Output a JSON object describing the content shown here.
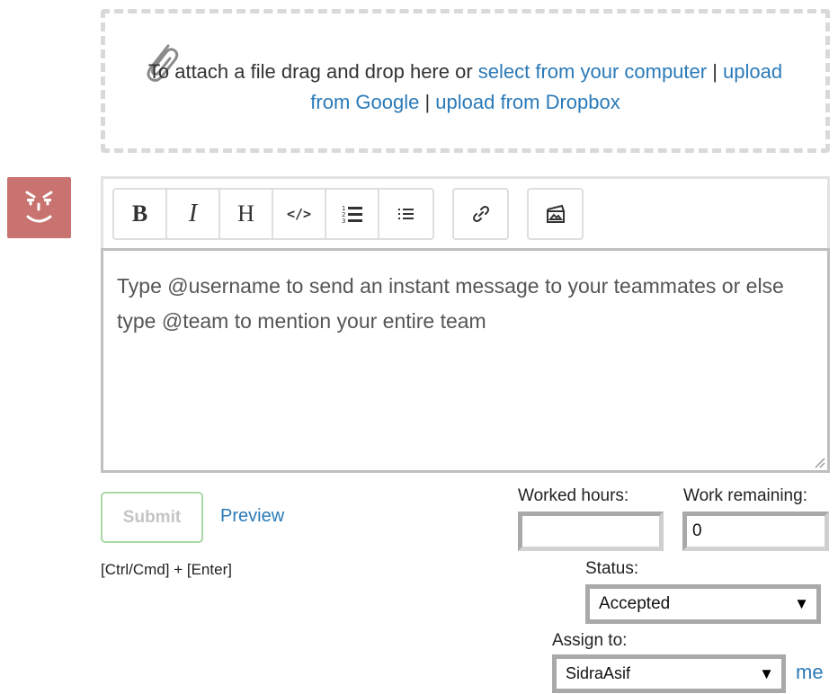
{
  "dropzone": {
    "prefix": "To attach a file drag and drop here or ",
    "link_select": "select from your computer",
    "sep1": " | ",
    "link_google": "upload from Google",
    "sep2": " | ",
    "link_dropbox": "upload from Dropbox",
    "icon": "paperclip-icon"
  },
  "toolbar": {
    "bold": "B",
    "italic": "I",
    "heading": "H",
    "code": "</>",
    "icons": [
      "bold-icon",
      "italic-icon",
      "heading-icon",
      "code-icon",
      "ordered-list-icon",
      "unordered-list-icon",
      "link-icon",
      "image-icon"
    ]
  },
  "editor": {
    "placeholder": "Type @username to send an instant message to your teammates or else type @team to mention your entire team"
  },
  "actions": {
    "submit_label": "Submit",
    "preview_label": "Preview",
    "shortcut": "[Ctrl/Cmd] + [Enter]"
  },
  "fields": {
    "worked_hours_label": "Worked hours:",
    "worked_hours_value": "",
    "work_remaining_label": "Work remaining:",
    "work_remaining_value": "0",
    "status_label": "Status:",
    "status_value": "Accepted",
    "assign_label": "Assign to:",
    "assign_value": "SidraAsif",
    "me_link": "me"
  },
  "colors": {
    "link": "#2a7ab8",
    "avatar_bg": "#c8736f",
    "submit_border": "#a8d9a4"
  }
}
